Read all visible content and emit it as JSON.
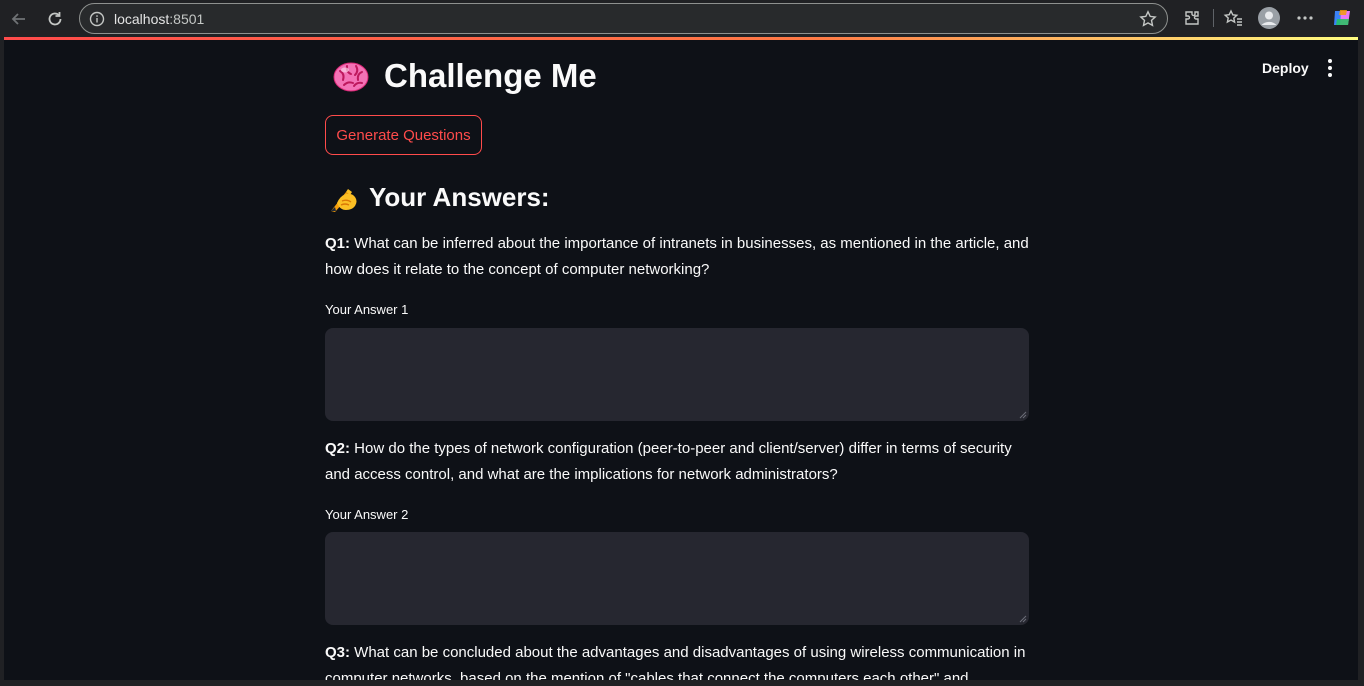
{
  "browser": {
    "url_host": "localhost",
    "url_port": ":8501"
  },
  "app": {
    "deploy_label": "Deploy",
    "title": "Challenge Me",
    "generate_button": "Generate Questions",
    "answers_heading": "Your Answers:",
    "questions": [
      {
        "prefix": "Q1:",
        "text": " What can be inferred about the importance of intranets in businesses, as mentioned in the article, and how does it relate to the concept of computer networking?",
        "answer_label": "Your Answer 1",
        "answer_value": ""
      },
      {
        "prefix": "Q2:",
        "text": " How do the types of network configuration (peer-to-peer and client/server) differ in terms of security and access control, and what are the implications for network administrators?",
        "answer_label": "Your Answer 2",
        "answer_value": ""
      },
      {
        "prefix": "Q3:",
        "text": " What can be concluded about the advantages and disadvantages of using wireless communication in computer networks, based on the mention of \"cables that connect the computers each other\" and"
      }
    ]
  },
  "colors": {
    "background": "#0e1117",
    "accent": "#ff4b4b",
    "input_bg": "#262730",
    "text": "#fafafa"
  }
}
